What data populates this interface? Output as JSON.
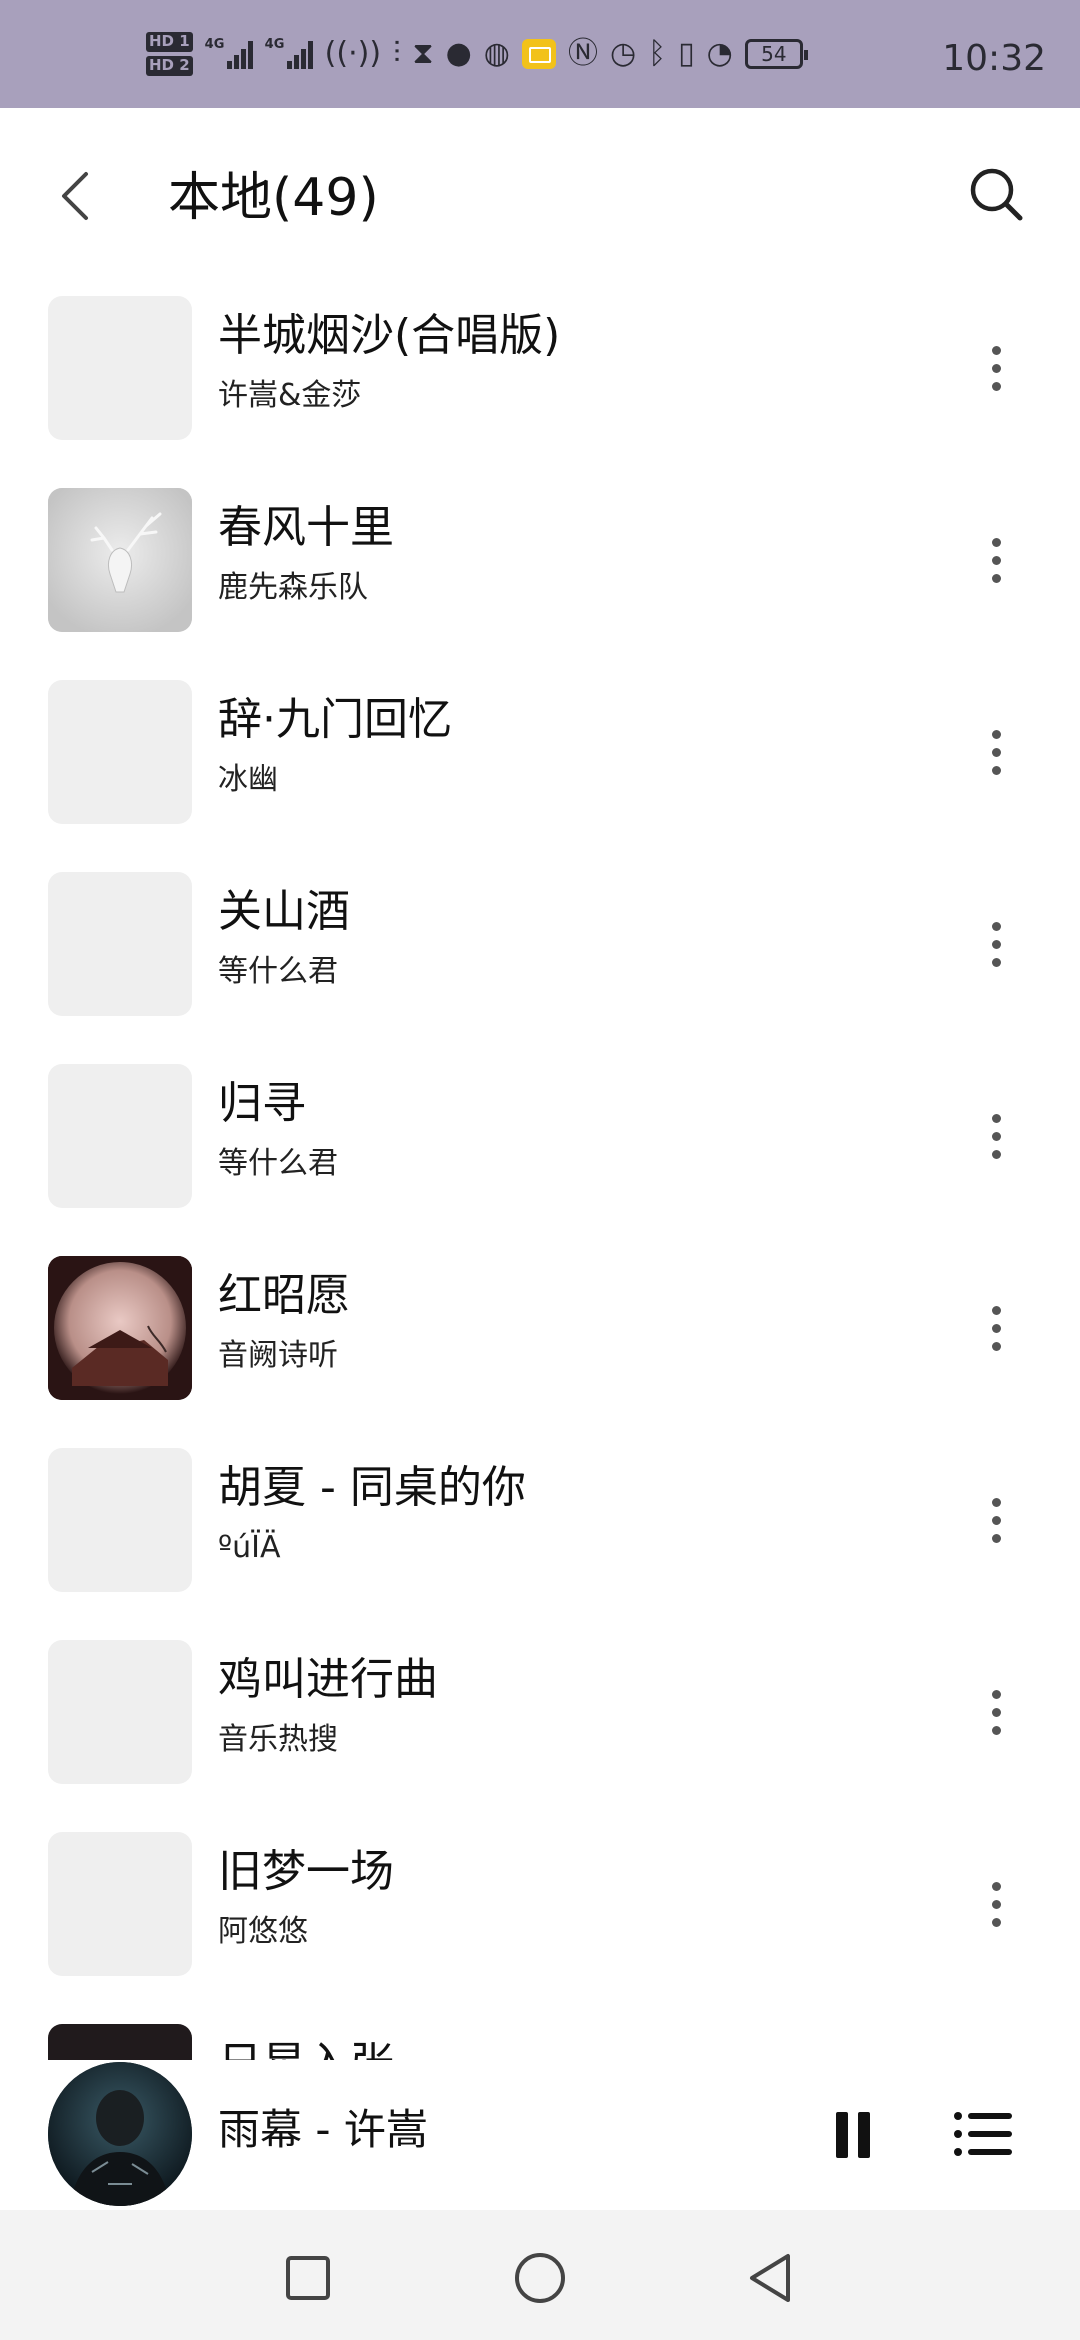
{
  "status_bar": {
    "sim1": "HD 1",
    "sim2": "HD 2",
    "net1": "4G",
    "net2": "4G",
    "hotspot_count": "1",
    "battery": "54",
    "time": "10:32"
  },
  "header": {
    "title": "本地(49)",
    "back_icon": "chevron-left-icon",
    "search_icon": "search-icon"
  },
  "songs": [
    {
      "title": "半城烟沙(合唱版)",
      "artist": "许嵩&金莎",
      "cover": "blank"
    },
    {
      "title": "春风十里",
      "artist": "鹿先森乐队",
      "cover": "deer-head-art"
    },
    {
      "title": "辞·九门回忆",
      "artist": "冰幽",
      "cover": "blank"
    },
    {
      "title": "关山酒",
      "artist": "等什么君",
      "cover": "blank"
    },
    {
      "title": "归寻",
      "artist": "等什么君",
      "cover": "blank"
    },
    {
      "title": "红昭愿",
      "artist": "音阙诗听",
      "cover": "pavilion-art"
    },
    {
      "title": "胡夏 - 同桌的你",
      "artist": "ºúÏÄ",
      "cover": "blank"
    },
    {
      "title": "鸡叫进行曲",
      "artist": "音乐热搜",
      "cover": "blank"
    },
    {
      "title": "旧梦一场",
      "artist": "阿悠悠",
      "cover": "blank"
    },
    {
      "title": "日星入张",
      "artist": "",
      "cover": "dark-art"
    }
  ],
  "now_playing": {
    "title": "雨幕 - 许嵩",
    "pause_icon": "pause-icon",
    "playlist_icon": "playlist-icon"
  },
  "nav_bar": {
    "recents_icon": "square-icon",
    "home_icon": "circle-icon",
    "back_icon": "triangle-back-icon"
  },
  "colors": {
    "status_bar_bg": "#a8a0bc",
    "cover_placeholder": "#efefef",
    "nav_bar_bg": "#f3f3f3"
  }
}
